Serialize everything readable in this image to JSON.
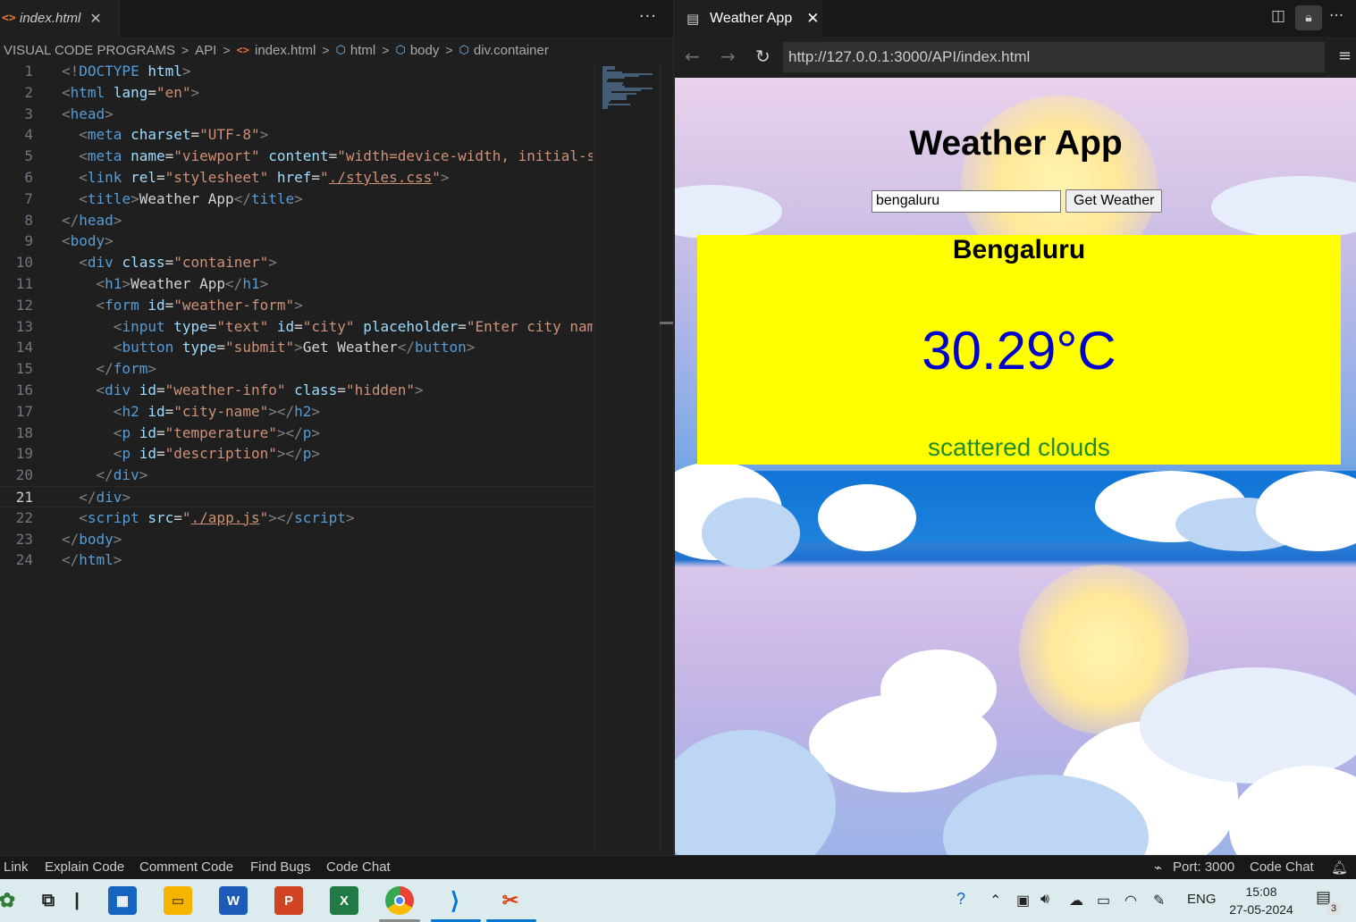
{
  "editor": {
    "tab_label": "index.html",
    "more_icon": "ellipsis-icon",
    "breadcrumb": [
      "VISUAL CODE PROGRAMS",
      "API",
      "index.html",
      "html",
      "body",
      "div.container"
    ],
    "lines": [
      {
        "n": "1",
        "tokens": [
          [
            "p",
            "<!"
          ],
          [
            "t",
            "DOCTYPE"
          ],
          [
            "x",
            " "
          ],
          [
            "a",
            "html"
          ],
          [
            "p",
            ">"
          ]
        ]
      },
      {
        "n": "2",
        "tokens": [
          [
            "p",
            "<"
          ],
          [
            "t",
            "html"
          ],
          [
            "x",
            " "
          ],
          [
            "a",
            "lang"
          ],
          [
            "x",
            "="
          ],
          [
            "s",
            "\"en\""
          ],
          [
            "p",
            ">"
          ]
        ]
      },
      {
        "n": "3",
        "tokens": [
          [
            "p",
            "<"
          ],
          [
            "t",
            "head"
          ],
          [
            "p",
            ">"
          ]
        ]
      },
      {
        "n": "4",
        "tokens": [
          [
            "x",
            "  "
          ],
          [
            "p",
            "<"
          ],
          [
            "t",
            "meta"
          ],
          [
            "x",
            " "
          ],
          [
            "a",
            "charset"
          ],
          [
            "x",
            "="
          ],
          [
            "s",
            "\"UTF-8\""
          ],
          [
            "p",
            ">"
          ]
        ]
      },
      {
        "n": "5",
        "tokens": [
          [
            "x",
            "  "
          ],
          [
            "p",
            "<"
          ],
          [
            "t",
            "meta"
          ],
          [
            "x",
            " "
          ],
          [
            "a",
            "name"
          ],
          [
            "x",
            "="
          ],
          [
            "s",
            "\"viewport\""
          ],
          [
            "x",
            " "
          ],
          [
            "a",
            "content"
          ],
          [
            "x",
            "="
          ],
          [
            "s",
            "\"width=device-width, initial-s"
          ]
        ]
      },
      {
        "n": "6",
        "tokens": [
          [
            "x",
            "  "
          ],
          [
            "p",
            "<"
          ],
          [
            "t",
            "link"
          ],
          [
            "x",
            " "
          ],
          [
            "a",
            "rel"
          ],
          [
            "x",
            "="
          ],
          [
            "s",
            "\"stylesheet\""
          ],
          [
            "x",
            " "
          ],
          [
            "a",
            "href"
          ],
          [
            "x",
            "="
          ],
          [
            "s",
            "\""
          ],
          [
            "u",
            "./styles.css"
          ],
          [
            "s",
            "\""
          ],
          [
            "p",
            ">"
          ]
        ]
      },
      {
        "n": "7",
        "tokens": [
          [
            "x",
            "  "
          ],
          [
            "p",
            "<"
          ],
          [
            "t",
            "title"
          ],
          [
            "p",
            ">"
          ],
          [
            "x",
            "Weather App"
          ],
          [
            "p",
            "</"
          ],
          [
            "t",
            "title"
          ],
          [
            "p",
            ">"
          ]
        ]
      },
      {
        "n": "8",
        "tokens": [
          [
            "p",
            "</"
          ],
          [
            "t",
            "head"
          ],
          [
            "p",
            ">"
          ]
        ]
      },
      {
        "n": "9",
        "tokens": [
          [
            "p",
            "<"
          ],
          [
            "t",
            "body"
          ],
          [
            "p",
            ">"
          ]
        ]
      },
      {
        "n": "10",
        "tokens": [
          [
            "x",
            "  "
          ],
          [
            "p",
            "<"
          ],
          [
            "t",
            "div"
          ],
          [
            "x",
            " "
          ],
          [
            "a",
            "class"
          ],
          [
            "x",
            "="
          ],
          [
            "s",
            "\"container\""
          ],
          [
            "p",
            ">"
          ]
        ]
      },
      {
        "n": "11",
        "tokens": [
          [
            "x",
            "    "
          ],
          [
            "p",
            "<"
          ],
          [
            "t",
            "h1"
          ],
          [
            "p",
            ">"
          ],
          [
            "x",
            "Weather App"
          ],
          [
            "p",
            "</"
          ],
          [
            "t",
            "h1"
          ],
          [
            "p",
            ">"
          ]
        ]
      },
      {
        "n": "12",
        "tokens": [
          [
            "x",
            "    "
          ],
          [
            "p",
            "<"
          ],
          [
            "t",
            "form"
          ],
          [
            "x",
            " "
          ],
          [
            "a",
            "id"
          ],
          [
            "x",
            "="
          ],
          [
            "s",
            "\"weather-form\""
          ],
          [
            "p",
            ">"
          ]
        ]
      },
      {
        "n": "13",
        "tokens": [
          [
            "x",
            "      "
          ],
          [
            "p",
            "<"
          ],
          [
            "t",
            "input"
          ],
          [
            "x",
            " "
          ],
          [
            "a",
            "type"
          ],
          [
            "x",
            "="
          ],
          [
            "s",
            "\"text\""
          ],
          [
            "x",
            " "
          ],
          [
            "a",
            "id"
          ],
          [
            "x",
            "="
          ],
          [
            "s",
            "\"city\""
          ],
          [
            "x",
            " "
          ],
          [
            "a",
            "placeholder"
          ],
          [
            "x",
            "="
          ],
          [
            "s",
            "\"Enter city nam"
          ]
        ]
      },
      {
        "n": "14",
        "tokens": [
          [
            "x",
            "      "
          ],
          [
            "p",
            "<"
          ],
          [
            "t",
            "button"
          ],
          [
            "x",
            " "
          ],
          [
            "a",
            "type"
          ],
          [
            "x",
            "="
          ],
          [
            "s",
            "\"submit\""
          ],
          [
            "p",
            ">"
          ],
          [
            "x",
            "Get Weather"
          ],
          [
            "p",
            "</"
          ],
          [
            "t",
            "button"
          ],
          [
            "p",
            ">"
          ]
        ]
      },
      {
        "n": "15",
        "tokens": [
          [
            "x",
            "    "
          ],
          [
            "p",
            "</"
          ],
          [
            "t",
            "form"
          ],
          [
            "p",
            ">"
          ]
        ]
      },
      {
        "n": "16",
        "tokens": [
          [
            "x",
            "    "
          ],
          [
            "p",
            "<"
          ],
          [
            "t",
            "div"
          ],
          [
            "x",
            " "
          ],
          [
            "a",
            "id"
          ],
          [
            "x",
            "="
          ],
          [
            "s",
            "\"weather-info\""
          ],
          [
            "x",
            " "
          ],
          [
            "a",
            "class"
          ],
          [
            "x",
            "="
          ],
          [
            "s",
            "\"hidden\""
          ],
          [
            "p",
            ">"
          ]
        ]
      },
      {
        "n": "17",
        "tokens": [
          [
            "x",
            "      "
          ],
          [
            "p",
            "<"
          ],
          [
            "t",
            "h2"
          ],
          [
            "x",
            " "
          ],
          [
            "a",
            "id"
          ],
          [
            "x",
            "="
          ],
          [
            "s",
            "\"city-name\""
          ],
          [
            "p",
            "></"
          ],
          [
            "t",
            "h2"
          ],
          [
            "p",
            ">"
          ]
        ]
      },
      {
        "n": "18",
        "tokens": [
          [
            "x",
            "      "
          ],
          [
            "p",
            "<"
          ],
          [
            "t",
            "p"
          ],
          [
            "x",
            " "
          ],
          [
            "a",
            "id"
          ],
          [
            "x",
            "="
          ],
          [
            "s",
            "\"temperature\""
          ],
          [
            "p",
            "></"
          ],
          [
            "t",
            "p"
          ],
          [
            "p",
            ">"
          ]
        ]
      },
      {
        "n": "19",
        "tokens": [
          [
            "x",
            "      "
          ],
          [
            "p",
            "<"
          ],
          [
            "t",
            "p"
          ],
          [
            "x",
            " "
          ],
          [
            "a",
            "id"
          ],
          [
            "x",
            "="
          ],
          [
            "s",
            "\"description\""
          ],
          [
            "p",
            "></"
          ],
          [
            "t",
            "p"
          ],
          [
            "p",
            ">"
          ]
        ]
      },
      {
        "n": "20",
        "tokens": [
          [
            "x",
            "    "
          ],
          [
            "p",
            "</"
          ],
          [
            "t",
            "div"
          ],
          [
            "p",
            ">"
          ]
        ]
      },
      {
        "n": "21",
        "tokens": [
          [
            "x",
            "  "
          ],
          [
            "p",
            "</"
          ],
          [
            "t",
            "div"
          ],
          [
            "p",
            ">"
          ]
        ],
        "active": true
      },
      {
        "n": "22",
        "tokens": [
          [
            "x",
            "  "
          ],
          [
            "p",
            "<"
          ],
          [
            "t",
            "script"
          ],
          [
            "x",
            " "
          ],
          [
            "a",
            "src"
          ],
          [
            "x",
            "="
          ],
          [
            "s",
            "\""
          ],
          [
            "u",
            "./app.js"
          ],
          [
            "s",
            "\""
          ],
          [
            "p",
            "></"
          ],
          [
            "t",
            "script"
          ],
          [
            "p",
            ">"
          ]
        ]
      },
      {
        "n": "23",
        "tokens": [
          [
            "p",
            "</"
          ],
          [
            "t",
            "body"
          ],
          [
            "p",
            ">"
          ]
        ]
      },
      {
        "n": "24",
        "tokens": [
          [
            "p",
            "</"
          ],
          [
            "t",
            "html"
          ],
          [
            "p",
            ">"
          ]
        ]
      }
    ]
  },
  "browser": {
    "tab_label": "Weather App",
    "url": "http://127.0.0.1:3000/API/index.html",
    "icons": {
      "back": "back-arrow-icon",
      "forward": "forward-arrow-icon",
      "reload": "reload-icon",
      "menu": "hamburger-menu-icon",
      "split": "split-editor-icon",
      "lock": "lock-icon",
      "more": "ellipsis-icon"
    }
  },
  "app": {
    "title": "Weather App",
    "city_value": "bengaluru",
    "city_placeholder": "",
    "button_label": "Get Weather",
    "city_name": "Bengaluru",
    "temperature": "30.29°C",
    "description": "scattered clouds",
    "colors": {
      "info_bg": "#ffff00",
      "temperature": "#0000cc",
      "description": "#228b22"
    }
  },
  "statusbar": {
    "left": [
      "Link",
      "Explain Code",
      "Comment Code",
      "Find Bugs",
      "Code Chat"
    ],
    "port": "Port: 3000",
    "right_chat": "Code Chat"
  },
  "taskbar": {
    "apps": [
      "task-view",
      "file-explorer-divider",
      "microsoft-store",
      "file-explorer",
      "word",
      "powerpoint",
      "excel",
      "chrome",
      "vs-code",
      "snipping-tool"
    ],
    "lang": "ENG",
    "time": "15:08",
    "date": "27-05-2024",
    "notification_count": "3"
  }
}
